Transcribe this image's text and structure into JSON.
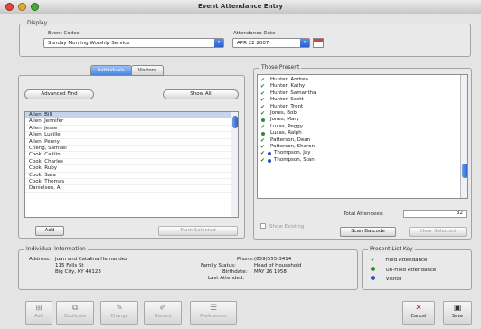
{
  "window": {
    "title": "Event Attendance Entry"
  },
  "display": {
    "group_label": "Display",
    "event_codes_label": "Event Codes",
    "event_value": "Sunday Morning Worship Service",
    "attendance_date_label": "Attendance Date",
    "date_value": "APR 22 2007"
  },
  "tabs": [
    {
      "label": "Individuals"
    },
    {
      "label": "Visitors"
    }
  ],
  "individuals": {
    "advanced_find": "Advanced Find",
    "show_all": "Show All",
    "names": [
      "Allen, Bill",
      "Allen, Jennifer",
      "Allen, Jesse",
      "Allen, Lucille",
      "Allen, Penny",
      "Cheng, Samuel",
      "Cook, Caitlin",
      "Cook, Charles",
      "Cook, Ruby",
      "Cook, Sara",
      "Cook, Thomas",
      "Danielsen, Al"
    ],
    "add": "Add",
    "mark_selected": "Mark Selected"
  },
  "present": {
    "group_label": "Those Present",
    "names": [
      "Hunter, Andrea",
      "Hunter, Kathy",
      "Hunter, Samantha",
      "Hunter, Scott",
      "Hunter, Trent",
      "Jones, Bob",
      "Jones, Mary",
      "Lucas, Peggy",
      "Lucas, Ralph",
      "Patterson, Dean",
      "Patterson, Sharon",
      "Thompson, Jay",
      "Thompson, Stan"
    ],
    "show_existing": "Show Existing",
    "total_label": "Total Attendees:",
    "total_value": "32",
    "scan_barcode": "Scan Barcode",
    "clear_selected": "Clear Selected"
  },
  "individual_info": {
    "group_label": "Individual Information",
    "address_label": "Address:",
    "address_lines": [
      "Juan and Catalina Hernandez",
      "115 Falls St",
      "Big City, KY 40123"
    ],
    "phone_label": "Phone:",
    "phone_value": "(859)555-3414",
    "family_status_label": "Family Status:",
    "family_status_value": "Head of Household",
    "birthdate_label": "Birthdate:",
    "birthdate_value": "MAY 26 1958",
    "last_attended_label": "Last Attended:"
  },
  "present_key": {
    "group_label": "Present List Key",
    "items": [
      "Filed Attendance",
      "Un-Filed Attendance",
      "Visitor"
    ],
    "colors": [
      "#2f8a2f",
      "#2f8a2f",
      "#2a4fc4"
    ]
  },
  "toolbar": {
    "add": "Add",
    "duplicate": "Duplicate",
    "change": "Change",
    "discard": "Discard",
    "preferences": "Preferences",
    "cancel": "Cancel",
    "save": "Save"
  },
  "icons": {
    "close": "close-light-icon",
    "minimize": "minimize-light-icon",
    "zoom": "zoom-light-icon",
    "calendar": "calendar-icon",
    "check": "checkmark-icon",
    "cancel": "x-icon",
    "save": "disk-icon"
  },
  "colors": {
    "accent": "#3a6fd8",
    "close_light": "#e2463c",
    "minimize_light": "#e5a92a",
    "zoom_light": "#4aa83a"
  }
}
